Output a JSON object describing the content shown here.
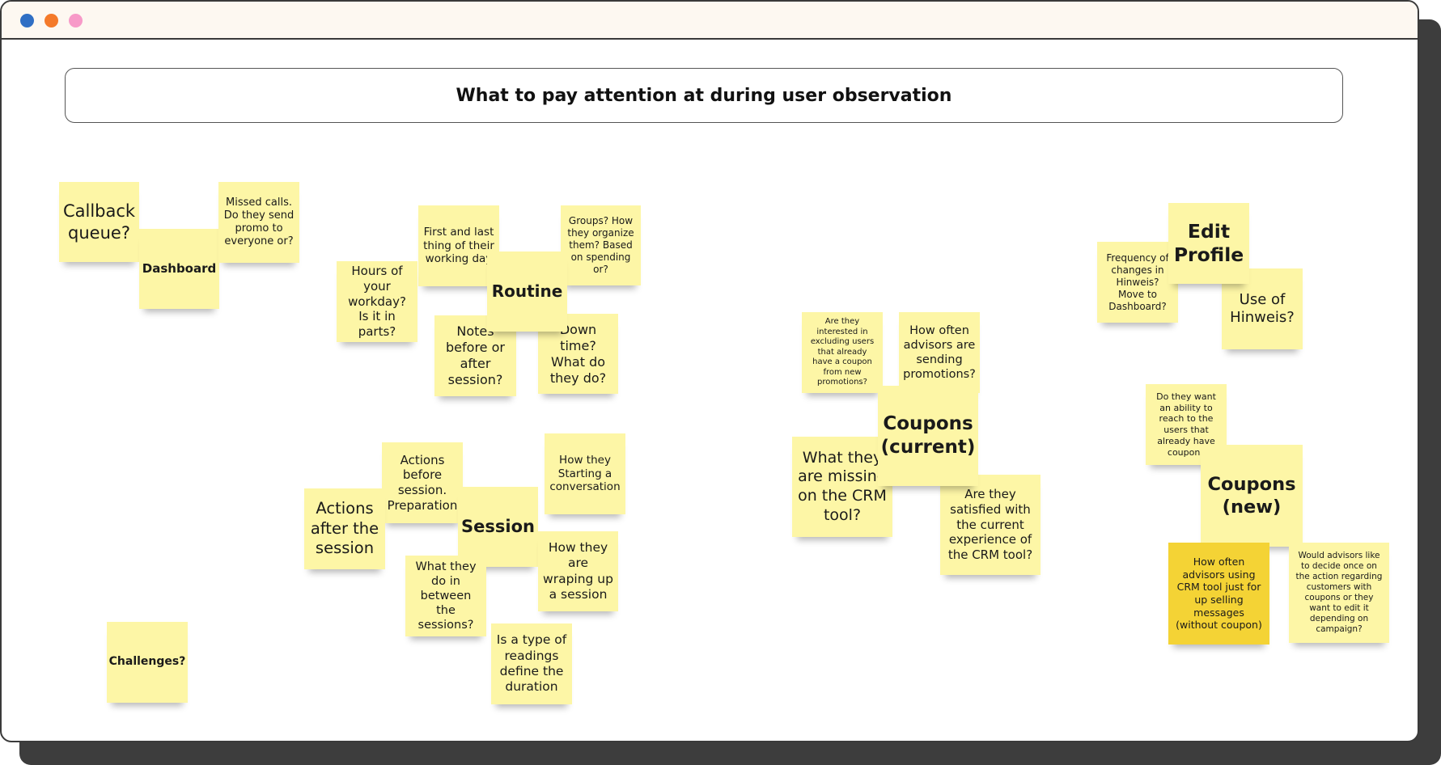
{
  "window": {
    "traffic_lights": [
      {
        "name": "close-dot",
        "color": "#2f6fc4"
      },
      {
        "name": "minimize-dot",
        "color": "#f47a2a"
      },
      {
        "name": "maximize-dot",
        "color": "#f79ac8"
      }
    ]
  },
  "board": {
    "title": "What to pay attention at during user observation"
  },
  "colors": {
    "note": "#fdf6a6",
    "note_dark": "#f4d335"
  },
  "notes": {
    "callback_queue": "Callback queue?",
    "dashboard": "Dashboard",
    "missed_calls": "Missed calls. Do they send promo to everyone or?",
    "first_last": "First and last thing of their working day",
    "groups": "Groups? How they organize them? Based on spending or?",
    "hours_workday": "Hours of your workday? Is it in parts?",
    "routine": "Routine",
    "notes_before_after": "Notes before or after session?",
    "down_time": "Down time? What do they do?",
    "actions_before": "Actions before session. Preparation",
    "how_starting": "How they Starting a conversation",
    "actions_after": "Actions after the session",
    "session": "Session",
    "wraping_up": "How they are wraping up a session",
    "in_between": "What they do in between the sessions?",
    "readings_type": "Is a type of readings define the duration",
    "challenges": "Challenges?",
    "excluding_users": "Are they interested in excluding users that already have a coupon from new promotions?",
    "how_often_sending": "How often advisors are sending promotions?",
    "coupons_current": "Coupons (current)",
    "missing_crm": "What they are missing on the CRM tool?",
    "satisfied_crm": "Are they satisfied with the current experience of the CRM tool?",
    "edit_profile": "Edit Profile",
    "frequency_changes": "Frequency of changes in Hinweis? Move to Dashboard?",
    "use_hinweis": "Use of Hinweis?",
    "reach_users": "Do they want an ability to reach to the users that already have coupons",
    "coupons_new": "Coupons (new)",
    "upselling": "How often advisors using CRM tool just for up selling messages (without coupon)",
    "decide_once": "Would advisors like to decide once on the action regarding customers with coupons or they want to edit it depending on campaign?"
  }
}
